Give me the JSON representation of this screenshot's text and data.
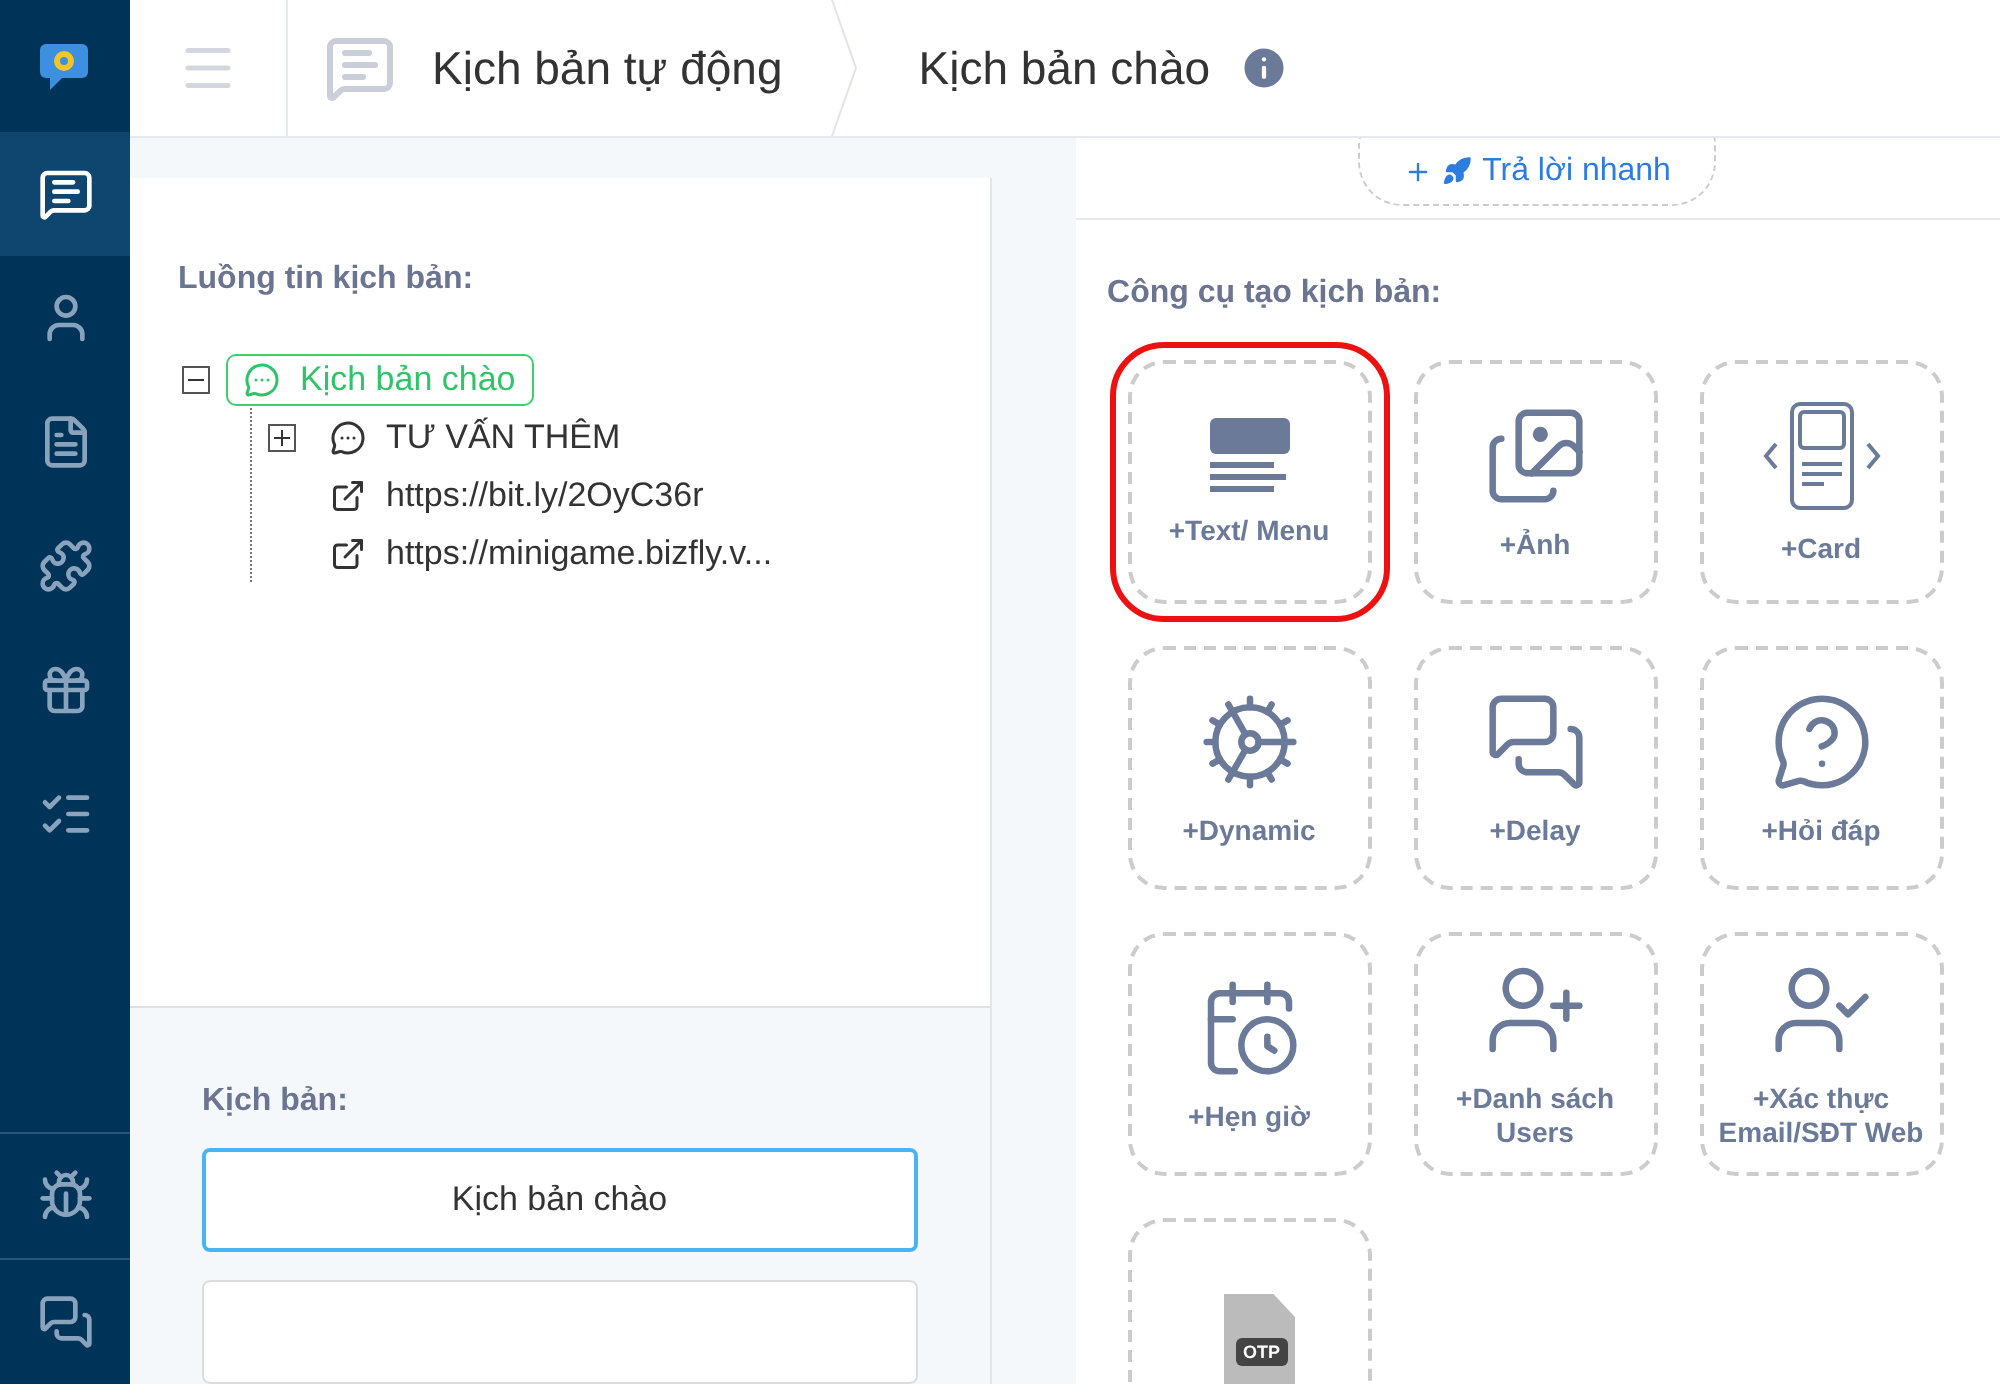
{
  "sidebar": {
    "items": [
      {
        "kind": "chat",
        "selected": true
      },
      {
        "kind": "user",
        "selected": false
      },
      {
        "kind": "docs",
        "selected": false
      },
      {
        "kind": "puzzle",
        "selected": false
      },
      {
        "kind": "gift",
        "selected": false
      },
      {
        "kind": "checklist",
        "selected": false
      }
    ],
    "bottom_items": [
      {
        "kind": "bug",
        "selected": false
      },
      {
        "kind": "chat",
        "selected": false
      }
    ]
  },
  "breadcrumb": [
    {
      "label": "Kịch bản tự động"
    },
    {
      "label": "Kịch bản chào"
    }
  ],
  "flow": {
    "title": "Luồng tin kịch bản:",
    "tree": [
      {
        "label": "Kịch bản chào",
        "kind": "message",
        "selected": true,
        "expanded": true,
        "children": [
          {
            "label": "TƯ VẤN THÊM",
            "kind": "message",
            "selected": false,
            "expanded": false
          },
          {
            "label": "https://bit.ly/2OyC36r",
            "kind": "link",
            "selected": false
          },
          {
            "label": "https://minigame.bizfly.v...",
            "kind": "link",
            "selected": false
          }
        ]
      }
    ]
  },
  "scenarios": {
    "title": "Kịch bản:",
    "items": [
      {
        "label": "Kịch bản chào",
        "selected": true
      },
      {
        "selected": false
      }
    ]
  },
  "quick_reply": {
    "label": "Trả lời nhanh"
  },
  "tools": {
    "title": "Công cụ tạo kịch bản:",
    "items": [
      {
        "kind": "text",
        "label": "+Text/ Menu",
        "selected": true
      },
      {
        "kind": "image",
        "label": "+Ảnh",
        "selected": false
      },
      {
        "kind": "card",
        "label": "+Card",
        "selected": false
      },
      {
        "kind": "dynamic",
        "label": "+Dynamic",
        "selected": false
      },
      {
        "kind": "delay",
        "label": "+Delay",
        "selected": false
      },
      {
        "kind": "qa",
        "label": "+Hỏi đáp",
        "selected": false
      },
      {
        "kind": "timer",
        "label": "+Hẹn giờ",
        "selected": false
      },
      {
        "kind": "users",
        "label": "+Danh sách Users",
        "selected": false
      },
      {
        "kind": "verify",
        "label": "+Xác thực Email/SĐT Web",
        "selected": false
      },
      {
        "kind": "otp",
        "badge": "OTP",
        "selected": false
      }
    ]
  }
}
